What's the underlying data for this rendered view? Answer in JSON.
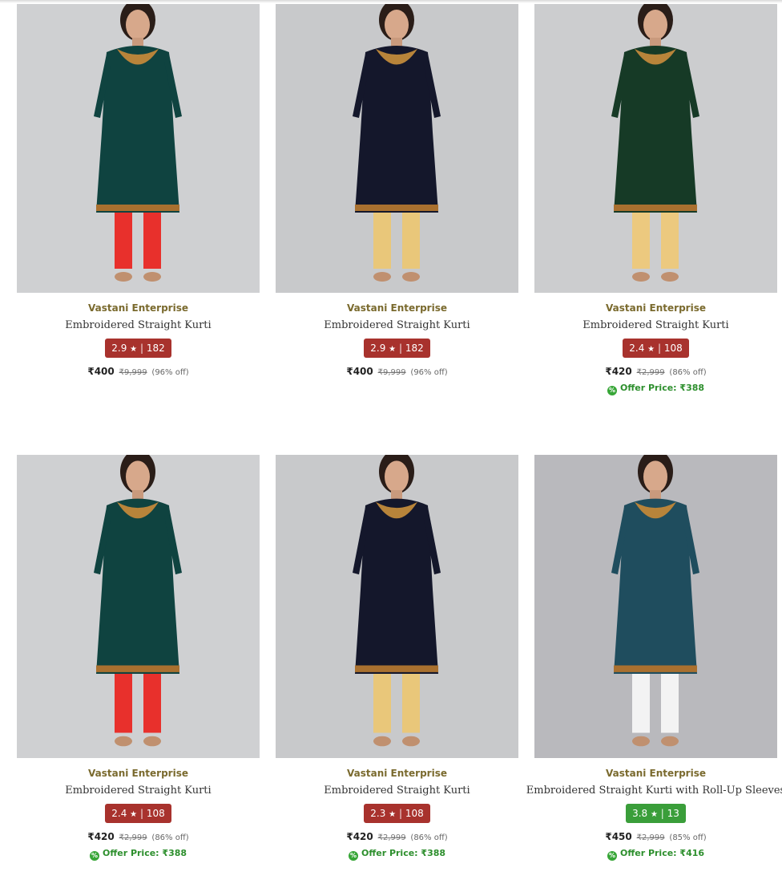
{
  "products": [
    {
      "brand": "Vastani Enterprise",
      "title": "Embroidered Straight Kurti",
      "rating": "2.9",
      "rating_count": "182",
      "rating_color": "#a8322d",
      "price": "₹400",
      "mrp": "₹9,999",
      "discount": "(96% off)",
      "offer": "",
      "kurta": "#0f4340",
      "pants": "#e8302c",
      "bg": "#cfd0d2"
    },
    {
      "brand": "Vastani Enterprise",
      "title": "Embroidered Straight Kurti",
      "rating": "2.9",
      "rating_count": "182",
      "rating_color": "#a8322d",
      "price": "₹400",
      "mrp": "₹9,999",
      "discount": "(96% off)",
      "offer": "",
      "kurta": "#14172b",
      "pants": "#e9c77a",
      "bg": "#c8c9cb"
    },
    {
      "brand": "Vastani Enterprise",
      "title": "Embroidered Straight Kurti",
      "rating": "2.4",
      "rating_count": "108",
      "rating_color": "#a8322d",
      "price": "₹420",
      "mrp": "₹2,999",
      "discount": "(86% off)",
      "offer": "Offer Price: ₹388",
      "kurta": "#163a26",
      "pants": "#ecc97f",
      "bg": "#cccdcf"
    },
    {
      "brand": "Vastani Enterprise",
      "title": "Embroidered Straight Kurti",
      "rating": "2.4",
      "rating_count": "108",
      "rating_color": "#a8322d",
      "price": "₹420",
      "mrp": "₹2,999",
      "discount": "(86% off)",
      "offer": "Offer Price: ₹388",
      "kurta": "#0f4340",
      "pants": "#e8302c",
      "bg": "#cfd0d2"
    },
    {
      "brand": "Vastani Enterprise",
      "title": "Embroidered Straight Kurti",
      "rating": "2.3",
      "rating_count": "108",
      "rating_color": "#a8322d",
      "price": "₹420",
      "mrp": "₹2,999",
      "discount": "(86% off)",
      "offer": "Offer Price: ₹388",
      "kurta": "#14172b",
      "pants": "#e9c77a",
      "bg": "#c8c9cb"
    },
    {
      "brand": "Vastani Enterprise",
      "title": "Embroidered Straight Kurti with Roll-Up Sleeves",
      "rating": "3.8",
      "rating_count": "13",
      "rating_color": "#3a9e3a",
      "price": "₹450",
      "mrp": "₹2,999",
      "discount": "(85% off)",
      "offer": "Offer Price: ₹416",
      "kurta": "#1f4d5e",
      "pants": "#f3f3f3",
      "bg": "#b9b9bd"
    }
  ],
  "icons": {
    "star": "star-icon",
    "offer": "offer-tag-icon"
  }
}
